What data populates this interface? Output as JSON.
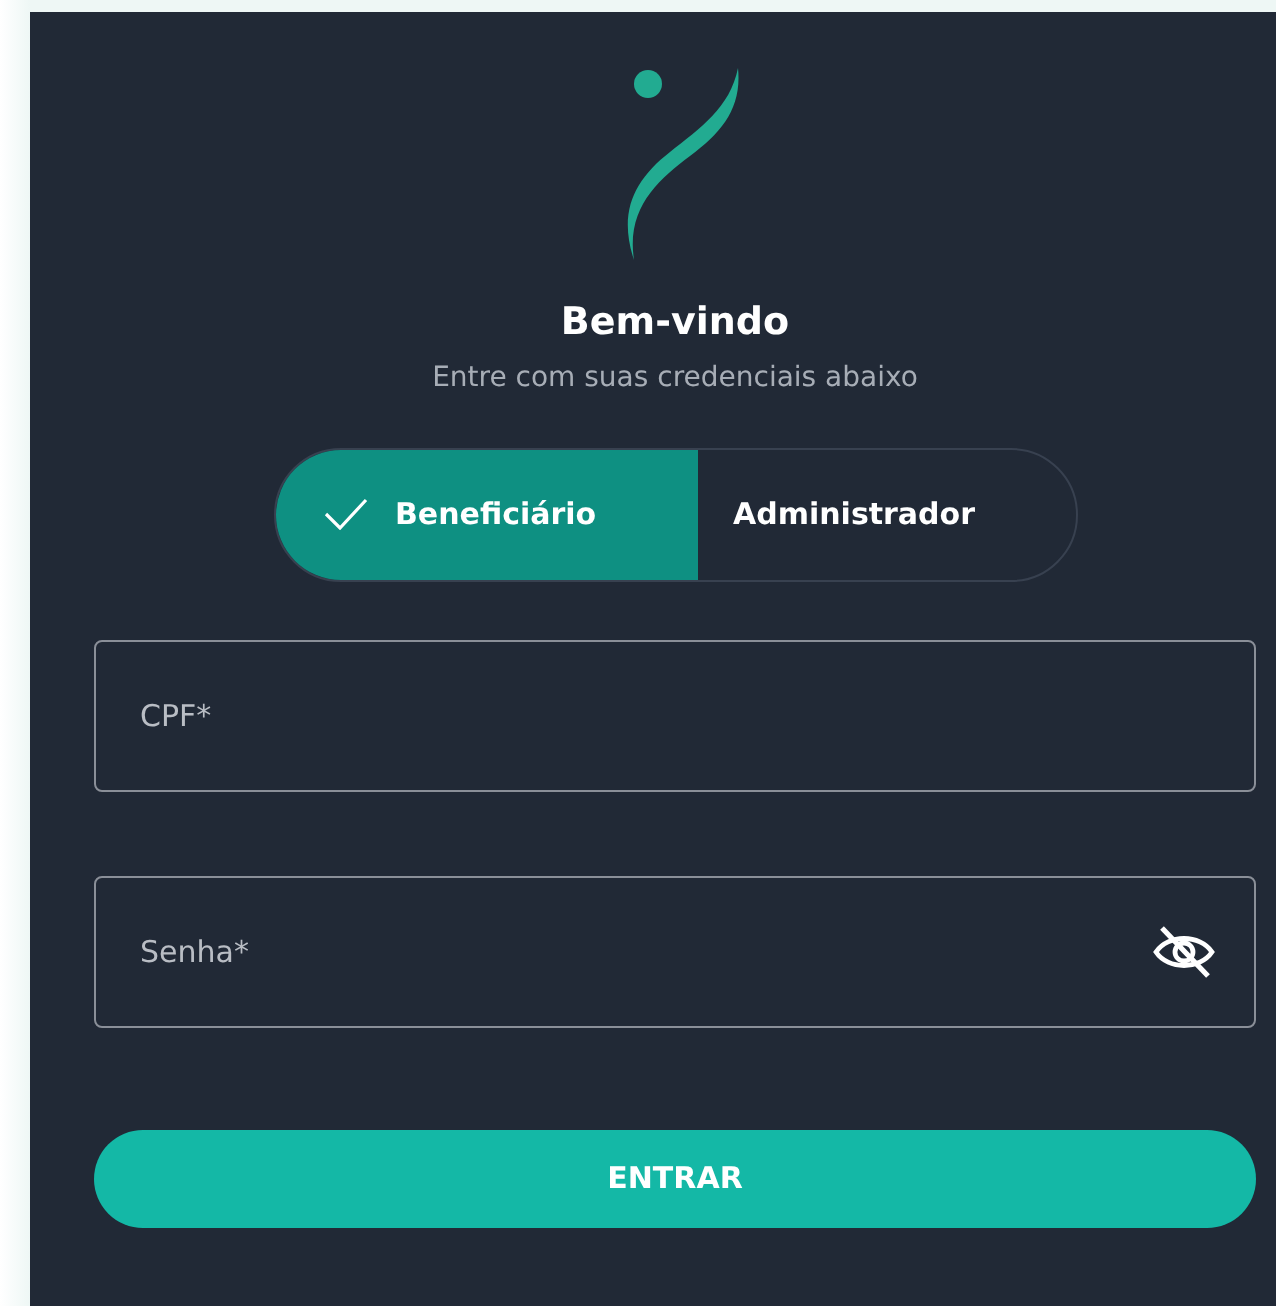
{
  "title": "Bem-vindo",
  "subtitle": "Entre com suas credenciais abaixo",
  "roles": [
    {
      "label": "Beneficiário",
      "selected": true
    },
    {
      "label": "Administrador",
      "selected": false
    }
  ],
  "fields": [
    {
      "placeholder": "CPF*",
      "kind": "text"
    },
    {
      "placeholder": "Senha*",
      "kind": "password"
    }
  ],
  "submit": "ENTRAR"
}
